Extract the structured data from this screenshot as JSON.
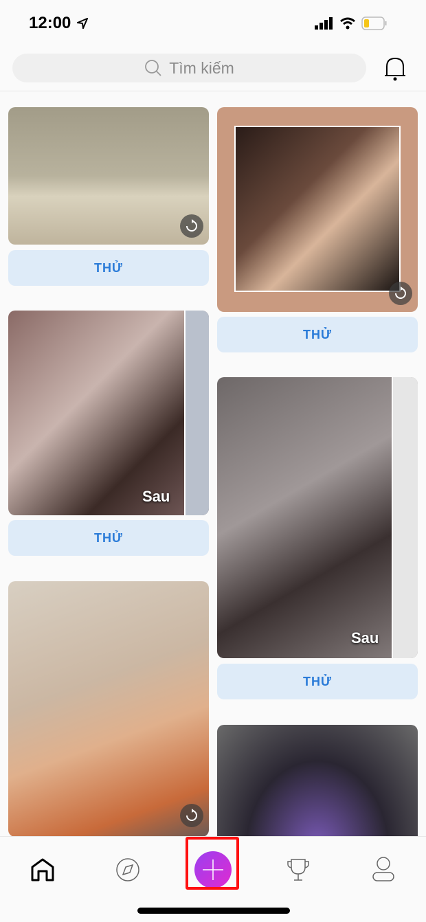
{
  "status": {
    "time": "12:00",
    "battery_color": "#f5c518"
  },
  "search": {
    "placeholder": "Tìm kiếm"
  },
  "feed": {
    "left": [
      {
        "button": "THỬ",
        "replay": true
      },
      {
        "button": "THỬ",
        "badge": "Sau"
      },
      {
        "replay": true
      }
    ],
    "right": [
      {
        "button": "THỬ",
        "replay": true
      },
      {
        "button": "THỬ",
        "badge": "Sau"
      },
      {}
    ]
  },
  "tabbar": {
    "items": [
      "home-icon",
      "explore-compass-icon",
      "create-plus-icon",
      "challenges-trophy-icon",
      "profile-icon"
    ],
    "accent": "#c135e0",
    "highlight": "#ff1010"
  }
}
